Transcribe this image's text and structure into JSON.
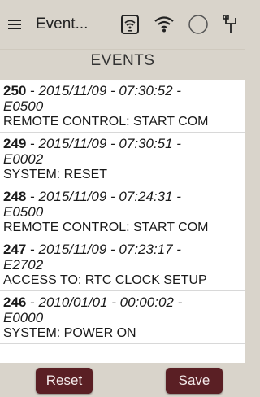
{
  "topbar": {
    "title": "Event...",
    "icons": [
      "menu-icon",
      "tablet-wifi-icon",
      "wifi-icon",
      "circle-icon",
      "usb-icon"
    ]
  },
  "header": {
    "title": "EVENTS"
  },
  "events": [
    {
      "id": "250",
      "sep": " - ",
      "timestamp": "2015/11/09 - 07:30:52 -",
      "code": "E0500",
      "message": "REMOTE CONTROL: START COM"
    },
    {
      "id": "249",
      "sep": " - ",
      "timestamp": "2015/11/09 - 07:30:51 -",
      "code": "E0002",
      "message": "SYSTEM: RESET"
    },
    {
      "id": "248",
      "sep": " - ",
      "timestamp": "2015/11/09 - 07:24:31 -",
      "code": "E0500",
      "message": "REMOTE CONTROL: START COM"
    },
    {
      "id": "247",
      "sep": " - ",
      "timestamp": "2015/11/09 - 07:23:17 -",
      "code": "E2702",
      "message": "ACCESS TO: RTC CLOCK SETUP"
    },
    {
      "id": "246",
      "sep": " - ",
      "timestamp": "2010/01/01 - 00:00:02 -",
      "code": "E0000",
      "message": "SYSTEM: POWER ON"
    }
  ],
  "buttons": {
    "reset": "Reset",
    "save": "Save"
  },
  "colors": {
    "background": "#d9d4cb",
    "list_bg": "#ffffff",
    "button_bg": "#5a1f24"
  }
}
